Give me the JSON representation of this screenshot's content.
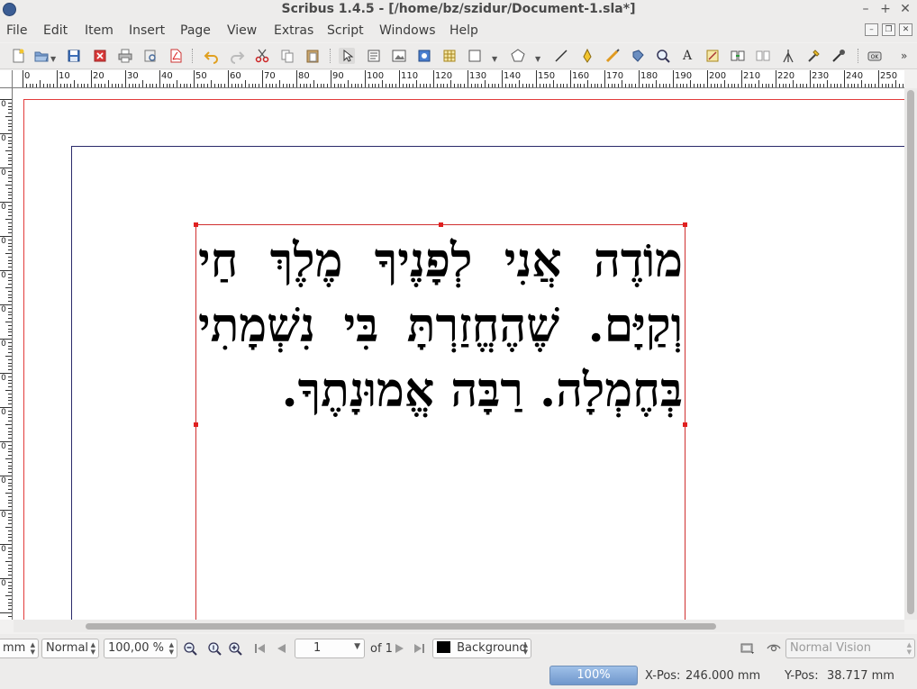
{
  "window": {
    "title": "Scribus 1.4.5 - [/home/bz/szidur/Document-1.sla*]",
    "controls": {
      "minimize": "–",
      "maximize": "+",
      "close": "✕"
    }
  },
  "menubar": {
    "items": [
      "File",
      "Edit",
      "Item",
      "Insert",
      "Page",
      "View",
      "Extras",
      "Script",
      "Windows",
      "Help"
    ]
  },
  "toolbar": {
    "icons": [
      "new-document-icon",
      "open-document-icon",
      "save-icon",
      "close-document-icon",
      "print-icon",
      "preflight-verifier-icon",
      "save-as-pdf-icon",
      "undo-icon",
      "redo-icon",
      "cut-icon",
      "copy-icon",
      "paste-icon",
      "select-item-icon",
      "text-frame-icon",
      "image-frame-icon",
      "render-frame-icon",
      "table-icon",
      "shape-icon",
      "polygon-icon",
      "line-icon",
      "bezier-curve-icon",
      "freehand-line-icon",
      "rotate-item-icon",
      "zoom-icon",
      "edit-text-icon",
      "story-editor-icon",
      "link-text-frames-icon",
      "unlink-text-frames-icon",
      "measurements-icon",
      "copy-properties-icon",
      "eye-dropper-icon",
      "pdf-push-button-icon",
      "more-tools-icon"
    ]
  },
  "ruler": {
    "unit": "mm",
    "horizontal_labels": [
      "0",
      "10",
      "20",
      "30",
      "40",
      "50",
      "60",
      "70",
      "80",
      "90",
      "100",
      "110",
      "120",
      "130",
      "140",
      "150",
      "160",
      "170",
      "180",
      "190",
      "200",
      "210",
      "220",
      "230",
      "240",
      "250"
    ],
    "vertical_labels": [
      "0",
      "10",
      "20",
      "30",
      "40",
      "50",
      "60",
      "70",
      "80",
      "90",
      "100",
      "110",
      "120",
      "130",
      "140",
      "150"
    ]
  },
  "canvas": {
    "text_frame_content": "מוֹדֶה אֲנִי לְפָנֶיךָ מֶלֶךְ חַי וְקַיָּם. שֶׁהֶחֱזַרְתָּ בִּי נִשְׁמָתִי בְּחֶמְלָה. רַבָּה אֱמוּנָתֶךָ."
  },
  "bottombar": {
    "unit": "mm",
    "image_quality": "Normal",
    "zoom_value": "100,00 %",
    "page_number": "1",
    "page_count": "of 1",
    "layer": "Background",
    "layer_color": "#000000",
    "preview_mode": "Normal Vision"
  },
  "statusbar": {
    "zoom_percent": "100%",
    "x_pos_label": "X-Pos:",
    "x_pos_value": "246.000 mm",
    "y_pos_label": "Y-Pos:",
    "y_pos_value": "38.717 mm"
  },
  "colors": {
    "bleed_guide": "#e23b3b",
    "margin_guide": "#2a2a6a",
    "frame_border": "#d03030",
    "zoom_bar": "#7fa3d4"
  }
}
